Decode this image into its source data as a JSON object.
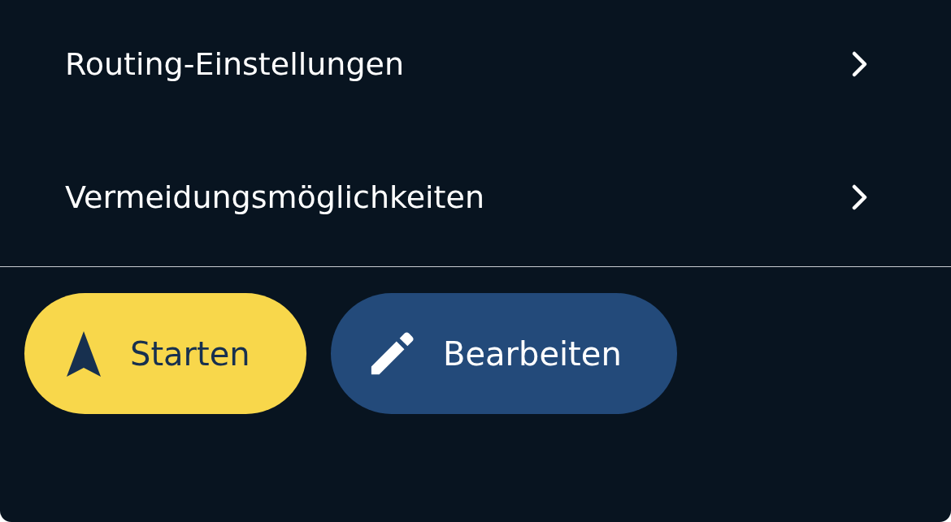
{
  "menu_items": [
    {
      "label": "Routing-Einstellungen"
    },
    {
      "label": "Vermeidungsmöglichkeiten"
    }
  ],
  "buttons": [
    {
      "kind": "primary",
      "label": "Starten"
    },
    {
      "kind": "secondary",
      "label": "Bearbeiten"
    }
  ]
}
